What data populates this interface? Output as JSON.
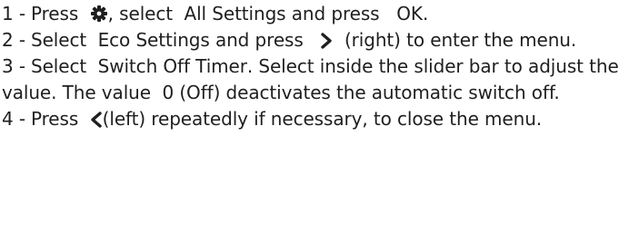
{
  "steps": [
    {
      "number": "1 -",
      "text_a": "Press",
      "icon_1": "gear-icon",
      "text_b": ", select",
      "bold_1": "All Settings",
      "text_c": "and press",
      "bold_2": "OK",
      "text_d": "."
    },
    {
      "number": "2 -",
      "text_a": "Select",
      "bold_1": "Eco Settings",
      "text_b": "and press",
      "icon_1": "chevron-right-icon",
      "text_c": "(right) to enter the menu."
    },
    {
      "number": "3 -",
      "text_a": "Select",
      "bold_1": "Switch Off Timer",
      "text_b": ". Select inside the slider bar to adjust the value. The value",
      "bold_2": "0",
      "text_c": "(Off) deactivates the automatic switch off."
    },
    {
      "number": "4 -",
      "text_a": "Press",
      "icon_1": "chevron-left-icon",
      "text_b": "(left) repeatedly if necessary, to close the menu."
    }
  ],
  "colors": {
    "text": "#1f1f1f"
  }
}
